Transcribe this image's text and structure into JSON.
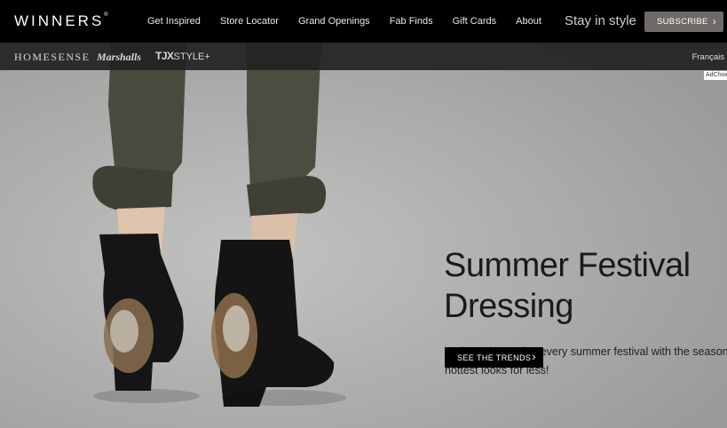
{
  "header": {
    "logo": "WINNERS",
    "nav": [
      "Get Inspired",
      "Store Locator",
      "Grand Openings",
      "Fab Finds",
      "Gift Cards",
      "About"
    ],
    "tagline": "Stay in style",
    "subscribe_label": "SUBSCRIBE"
  },
  "subbar": {
    "brands": {
      "homesense": "HOMESENSE",
      "marshalls": "Marshalls",
      "tjx": "TJX",
      "tjx_suffix": "STYLE+"
    },
    "language": "Français"
  },
  "hero": {
    "adchoices": "AdChoices",
    "headline": "Summer Festival Dressing",
    "description": "Be best dressed at every summer festival with the season's hottest looks for less!",
    "cta_label": "SEE THE TRENDS"
  },
  "colors": {
    "topbar": "#000000",
    "subbar": "#222222",
    "subscribe": "#6e6a66",
    "cta": "#000000"
  }
}
